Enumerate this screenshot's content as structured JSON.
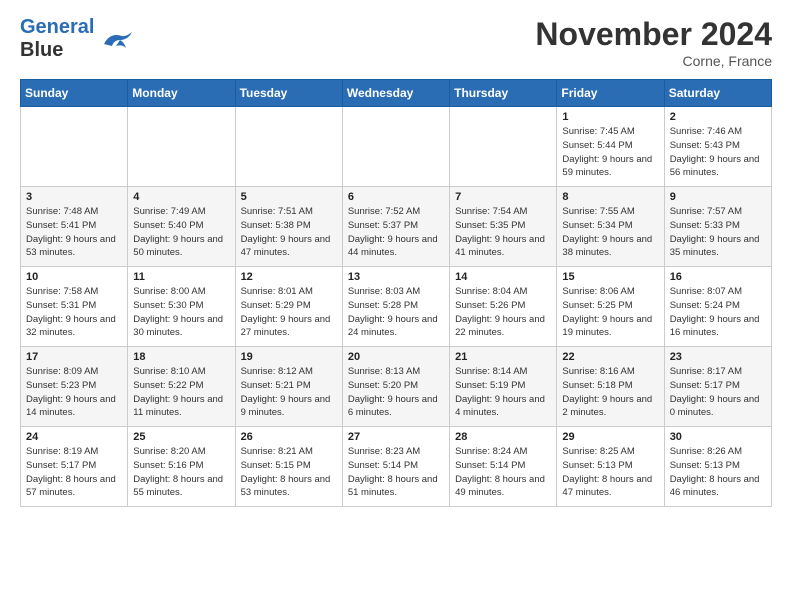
{
  "header": {
    "logo_line1": "General",
    "logo_line2": "Blue",
    "month": "November 2024",
    "location": "Corne, France"
  },
  "weekdays": [
    "Sunday",
    "Monday",
    "Tuesday",
    "Wednesday",
    "Thursday",
    "Friday",
    "Saturday"
  ],
  "weeks": [
    [
      {
        "day": "",
        "info": ""
      },
      {
        "day": "",
        "info": ""
      },
      {
        "day": "",
        "info": ""
      },
      {
        "day": "",
        "info": ""
      },
      {
        "day": "",
        "info": ""
      },
      {
        "day": "1",
        "info": "Sunrise: 7:45 AM\nSunset: 5:44 PM\nDaylight: 9 hours and 59 minutes."
      },
      {
        "day": "2",
        "info": "Sunrise: 7:46 AM\nSunset: 5:43 PM\nDaylight: 9 hours and 56 minutes."
      }
    ],
    [
      {
        "day": "3",
        "info": "Sunrise: 7:48 AM\nSunset: 5:41 PM\nDaylight: 9 hours and 53 minutes."
      },
      {
        "day": "4",
        "info": "Sunrise: 7:49 AM\nSunset: 5:40 PM\nDaylight: 9 hours and 50 minutes."
      },
      {
        "day": "5",
        "info": "Sunrise: 7:51 AM\nSunset: 5:38 PM\nDaylight: 9 hours and 47 minutes."
      },
      {
        "day": "6",
        "info": "Sunrise: 7:52 AM\nSunset: 5:37 PM\nDaylight: 9 hours and 44 minutes."
      },
      {
        "day": "7",
        "info": "Sunrise: 7:54 AM\nSunset: 5:35 PM\nDaylight: 9 hours and 41 minutes."
      },
      {
        "day": "8",
        "info": "Sunrise: 7:55 AM\nSunset: 5:34 PM\nDaylight: 9 hours and 38 minutes."
      },
      {
        "day": "9",
        "info": "Sunrise: 7:57 AM\nSunset: 5:33 PM\nDaylight: 9 hours and 35 minutes."
      }
    ],
    [
      {
        "day": "10",
        "info": "Sunrise: 7:58 AM\nSunset: 5:31 PM\nDaylight: 9 hours and 32 minutes."
      },
      {
        "day": "11",
        "info": "Sunrise: 8:00 AM\nSunset: 5:30 PM\nDaylight: 9 hours and 30 minutes."
      },
      {
        "day": "12",
        "info": "Sunrise: 8:01 AM\nSunset: 5:29 PM\nDaylight: 9 hours and 27 minutes."
      },
      {
        "day": "13",
        "info": "Sunrise: 8:03 AM\nSunset: 5:28 PM\nDaylight: 9 hours and 24 minutes."
      },
      {
        "day": "14",
        "info": "Sunrise: 8:04 AM\nSunset: 5:26 PM\nDaylight: 9 hours and 22 minutes."
      },
      {
        "day": "15",
        "info": "Sunrise: 8:06 AM\nSunset: 5:25 PM\nDaylight: 9 hours and 19 minutes."
      },
      {
        "day": "16",
        "info": "Sunrise: 8:07 AM\nSunset: 5:24 PM\nDaylight: 9 hours and 16 minutes."
      }
    ],
    [
      {
        "day": "17",
        "info": "Sunrise: 8:09 AM\nSunset: 5:23 PM\nDaylight: 9 hours and 14 minutes."
      },
      {
        "day": "18",
        "info": "Sunrise: 8:10 AM\nSunset: 5:22 PM\nDaylight: 9 hours and 11 minutes."
      },
      {
        "day": "19",
        "info": "Sunrise: 8:12 AM\nSunset: 5:21 PM\nDaylight: 9 hours and 9 minutes."
      },
      {
        "day": "20",
        "info": "Sunrise: 8:13 AM\nSunset: 5:20 PM\nDaylight: 9 hours and 6 minutes."
      },
      {
        "day": "21",
        "info": "Sunrise: 8:14 AM\nSunset: 5:19 PM\nDaylight: 9 hours and 4 minutes."
      },
      {
        "day": "22",
        "info": "Sunrise: 8:16 AM\nSunset: 5:18 PM\nDaylight: 9 hours and 2 minutes."
      },
      {
        "day": "23",
        "info": "Sunrise: 8:17 AM\nSunset: 5:17 PM\nDaylight: 9 hours and 0 minutes."
      }
    ],
    [
      {
        "day": "24",
        "info": "Sunrise: 8:19 AM\nSunset: 5:17 PM\nDaylight: 8 hours and 57 minutes."
      },
      {
        "day": "25",
        "info": "Sunrise: 8:20 AM\nSunset: 5:16 PM\nDaylight: 8 hours and 55 minutes."
      },
      {
        "day": "26",
        "info": "Sunrise: 8:21 AM\nSunset: 5:15 PM\nDaylight: 8 hours and 53 minutes."
      },
      {
        "day": "27",
        "info": "Sunrise: 8:23 AM\nSunset: 5:14 PM\nDaylight: 8 hours and 51 minutes."
      },
      {
        "day": "28",
        "info": "Sunrise: 8:24 AM\nSunset: 5:14 PM\nDaylight: 8 hours and 49 minutes."
      },
      {
        "day": "29",
        "info": "Sunrise: 8:25 AM\nSunset: 5:13 PM\nDaylight: 8 hours and 47 minutes."
      },
      {
        "day": "30",
        "info": "Sunrise: 8:26 AM\nSunset: 5:13 PM\nDaylight: 8 hours and 46 minutes."
      }
    ]
  ]
}
